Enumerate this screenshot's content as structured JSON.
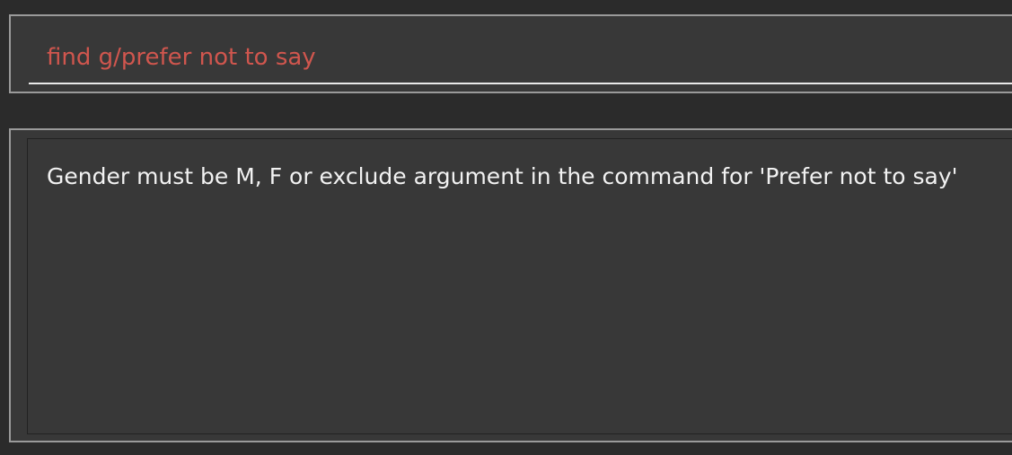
{
  "command_box": {
    "input_value": "find g/prefer not to say"
  },
  "result_display": {
    "message": "Gender must be M, F or exclude argument in the command for 'Prefer not to say'"
  },
  "colors": {
    "background": "#2b2b2b",
    "panel": "#383838",
    "command_text_error": "#d0564e",
    "result_text": "#f2f2f2",
    "border": "#9a9a9a"
  }
}
